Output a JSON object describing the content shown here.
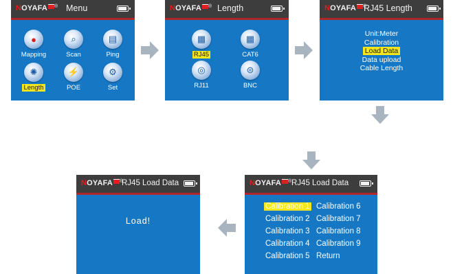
{
  "brand": {
    "name_prefix": "N",
    "name_rest": "OYAFA",
    "reg": "®"
  },
  "colors": {
    "screen_bg": "#1678c5",
    "topbar": "#3d3d3d",
    "accent_line": "#b0262a",
    "highlight": "#f5e61c",
    "arrow": "#a8b4c0"
  },
  "screens": {
    "menu": {
      "title": "Menu",
      "items": [
        {
          "label": "Mapping",
          "icon": "mapping-icon",
          "highlighted": false
        },
        {
          "label": "Scan",
          "icon": "scan-icon",
          "highlighted": false
        },
        {
          "label": "Ping",
          "icon": "ping-icon",
          "highlighted": false
        },
        {
          "label": "Length",
          "icon": "length-icon",
          "highlighted": true
        },
        {
          "label": "POE",
          "icon": "poe-icon",
          "highlighted": false
        },
        {
          "label": "Set",
          "icon": "settings-gear-icon",
          "highlighted": false
        }
      ],
      "battery_level": 0.8
    },
    "length": {
      "title": "Length",
      "items": [
        {
          "label": "RJ45",
          "icon": "rj45-port-icon",
          "highlighted": true
        },
        {
          "label": "CAT6",
          "icon": "cat6-port-icon",
          "highlighted": false
        },
        {
          "label": "RJ11",
          "icon": "rj11-port-icon",
          "highlighted": false
        },
        {
          "label": "BNC",
          "icon": "bnc-connector-icon",
          "highlighted": false
        }
      ],
      "battery_level": 0.8
    },
    "rj45_length": {
      "title": "RJ45 Length",
      "items": [
        {
          "label": "Unit:Meter",
          "highlighted": false
        },
        {
          "label": "Calibration",
          "highlighted": false
        },
        {
          "label": "Load Data",
          "highlighted": true
        },
        {
          "label": "Data upload",
          "highlighted": false
        },
        {
          "label": "Cable Length",
          "highlighted": false
        }
      ],
      "battery_level": 0.8
    },
    "load_data_menu": {
      "title": "RJ45 Load Data",
      "col1": [
        "Calibration 1",
        "Calibration 2",
        "Calibration 3",
        "Calibration 4",
        "Calibration 5"
      ],
      "col2": [
        "Calibration 6",
        "Calibration 7",
        "Calibration 8",
        "Calibration 9",
        "Return"
      ],
      "highlighted_index": 0,
      "battery_level": 0.8
    },
    "loading": {
      "title": "RJ45 Load Data",
      "message": "Load!",
      "battery_level": 0.8
    }
  }
}
